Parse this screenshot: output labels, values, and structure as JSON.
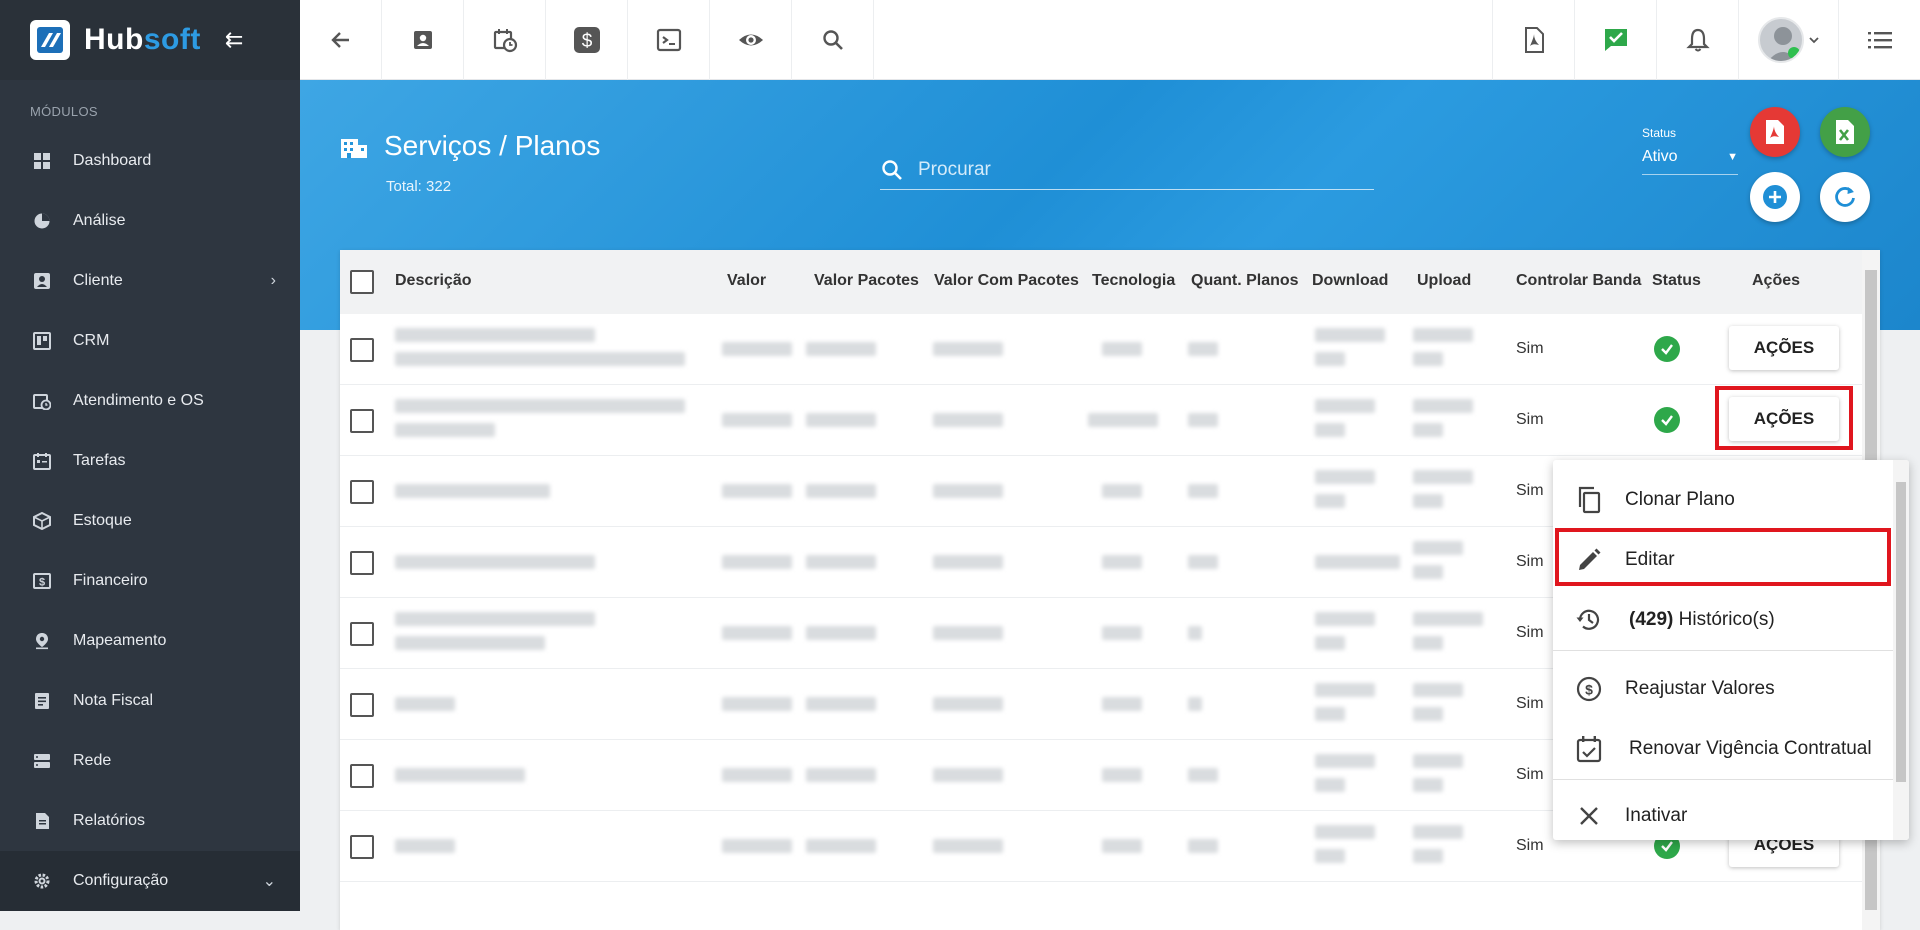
{
  "brand": {
    "hub": "Hub",
    "soft": "soft"
  },
  "sidebar": {
    "section_title": "MÓDULOS",
    "items": [
      {
        "label": "Dashboard",
        "icon": "dashboard-icon"
      },
      {
        "label": "Análise",
        "icon": "pie-chart-icon"
      },
      {
        "label": "Cliente",
        "icon": "contact-icon"
      },
      {
        "label": "CRM",
        "icon": "crm-board-icon"
      },
      {
        "label": "Atendimento e OS",
        "icon": "calendar-clock-icon"
      },
      {
        "label": "Tarefas",
        "icon": "tasks-icon"
      },
      {
        "label": "Estoque",
        "icon": "box-icon"
      },
      {
        "label": "Financeiro",
        "icon": "money-icon"
      },
      {
        "label": "Mapeamento",
        "icon": "map-pin-icon"
      },
      {
        "label": "Nota Fiscal",
        "icon": "receipt-icon"
      },
      {
        "label": "Rede",
        "icon": "server-icon"
      },
      {
        "label": "Relatórios",
        "icon": "report-icon"
      },
      {
        "label": "Configuração",
        "icon": "gear-icon"
      }
    ]
  },
  "header": {
    "title": "Serviços / Planos",
    "total": "Total: 322",
    "search_placeholder": "Procurar",
    "status_label": "Status",
    "status_value": "Ativo"
  },
  "table": {
    "columns": [
      "Descrição",
      "Valor",
      "Valor Pacotes",
      "Valor Com Pacotes",
      "Tecnologia",
      "Quant. Planos",
      "Download",
      "Upload",
      "Controlar Banda",
      "Status",
      "Ações"
    ],
    "rows": [
      {
        "controlar_banda": "Sim"
      },
      {
        "controlar_banda": "Sim"
      },
      {
        "controlar_banda": "Sim"
      },
      {
        "controlar_banda": "Sim"
      },
      {
        "controlar_banda": "Sim"
      },
      {
        "controlar_banda": "Sim"
      },
      {
        "controlar_banda": "Sim"
      },
      {
        "controlar_banda": "Sim"
      }
    ],
    "action_label": "AÇÕES"
  },
  "menu": {
    "items": [
      {
        "label": "Clonar Plano",
        "icon": "copy-icon"
      },
      {
        "label": "Editar",
        "icon": "pencil-icon"
      },
      {
        "count": "(429)",
        "label": "Histórico(s)",
        "icon": "history-icon"
      },
      {
        "label": "Reajustar Valores",
        "icon": "dollar-circle-icon"
      },
      {
        "label": "Renovar Vigência Contratual",
        "icon": "calendar-check-icon"
      },
      {
        "label": "Inativar",
        "icon": "close-icon"
      }
    ]
  },
  "colors": {
    "accent": "#1f8fd6",
    "sidebar": "#2e3640",
    "highlight": "#e0161e",
    "success": "#2ea84a",
    "pdf": "#e53935",
    "excel": "#43a047"
  }
}
